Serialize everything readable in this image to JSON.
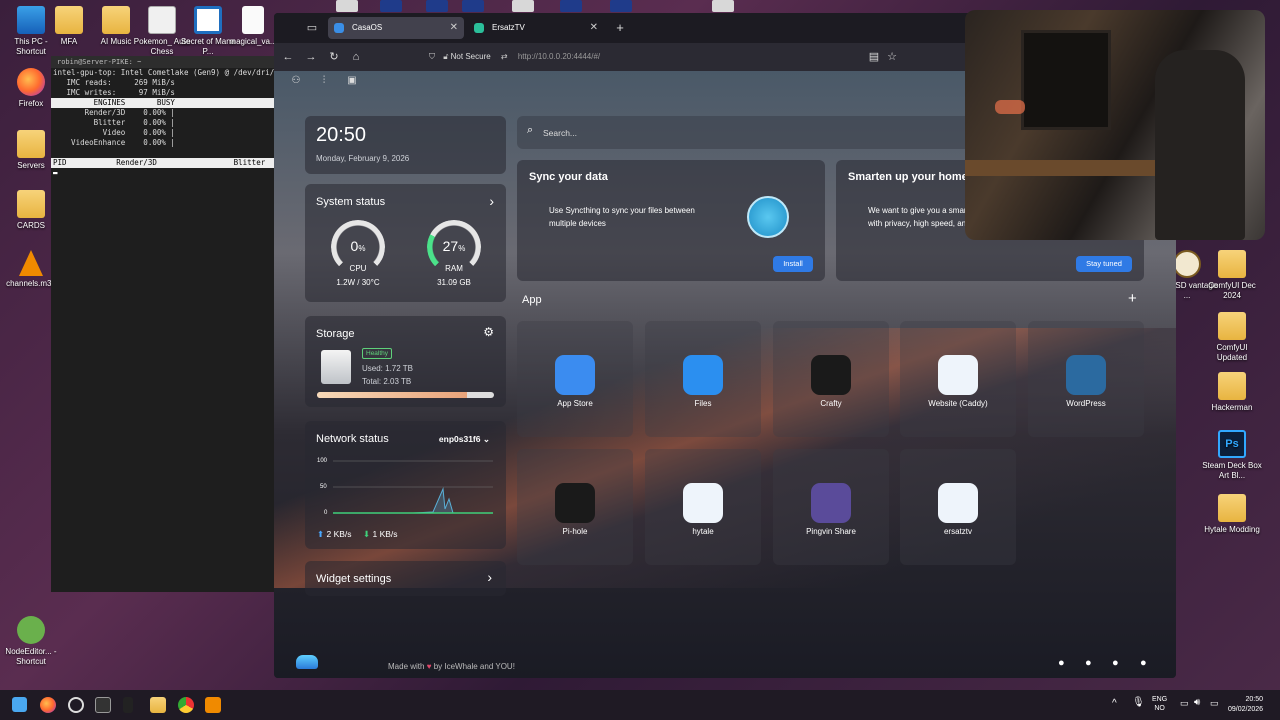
{
  "desktop": {
    "left_icons": [
      {
        "label": "This PC - Shortcut",
        "icon": "monitor-icon"
      },
      {
        "label": "Firefox",
        "icon": "firefox-icon"
      },
      {
        "label": "Servers",
        "icon": "folder-icon"
      },
      {
        "label": "CARDS",
        "icon": "folder-icon"
      },
      {
        "label": "channels.m3u",
        "icon": "vlc-icon"
      },
      {
        "label": "NodeEditor... - Shortcut",
        "icon": "node-icon"
      }
    ],
    "top_icons": [
      {
        "label": "MFA",
        "icon": "folder-icon"
      },
      {
        "label": "AI Music",
        "icon": "folder-icon"
      },
      {
        "label": "Pokemon_ Auto Chess",
        "icon": "game-icon"
      },
      {
        "label": "Secret of Mana P...",
        "icon": "app-icon"
      },
      {
        "label": "magical_va...",
        "icon": "file-icon"
      }
    ],
    "right_icons": [
      {
        "label": "ComfyUI Dec 2024",
        "icon": "folder-icon"
      },
      {
        "label": "ComfyUI Updated",
        "icon": "folder-icon"
      },
      {
        "label": "Hackerman",
        "icon": "folder-icon"
      },
      {
        "label": "Steam Deck Box Art Bl...",
        "icon": "photoshop-icon"
      },
      {
        "label": "Hytale Modding",
        "icon": "folder-icon"
      },
      {
        "label": "elkin SD vantage ...",
        "icon": "app-icon"
      }
    ]
  },
  "terminal": {
    "title": "robin@Server-PIKE: ~",
    "lines": [
      "intel-gpu-top: Intel Cometlake (Gen9) @ /dev/dri/c",
      "",
      "   IMC reads:     269 MiB/s",
      "   IMC writes:     97 MiB/s",
      ""
    ],
    "engines_header": "         ENGINES       BUSY",
    "engines": [
      "       Render/3D    0.00% |",
      "         Blitter    0.00% |",
      "           Video    0.00% |",
      "    VideoEnhance    0.00% |"
    ],
    "pid_header": "PID           Render/3D                 Blitter"
  },
  "browser": {
    "tabs": [
      {
        "label": "CasaOS",
        "color": "#3a8ee6"
      },
      {
        "label": "ErsatzTV",
        "color": "#2bbf9a"
      }
    ],
    "new_tab": "+",
    "not_secure": "Not Secure",
    "url": "http://10.0.0.20:4444/#/"
  },
  "casaos": {
    "time": "20:50",
    "date": "Monday, February 9, 2026",
    "system_status": {
      "title": "System status",
      "cpu_value": "0",
      "cpu_unit": "%",
      "cpu_label": "CPU",
      "cpu_info": "1.2W / 30°C",
      "cpu_fraction": 0.0,
      "ram_value": "27",
      "ram_unit": "%",
      "ram_label": "RAM",
      "ram_info": "31.09 GB",
      "ram_fraction": 0.27
    },
    "storage": {
      "title": "Storage",
      "badge": "Healthy",
      "used": "Used: 1.72 TB",
      "total": "Total: 2.03 TB",
      "used_fraction": 0.85
    },
    "network": {
      "title": "Network status",
      "interface": "enp0s31f6",
      "axis": [
        "100",
        "50",
        "0"
      ],
      "upload": "2 KB/s",
      "download": "1 KB/s"
    },
    "widget_settings": "Widget settings",
    "search_placeholder": "Search...",
    "promo_sync": {
      "title": "Sync your data",
      "text": "Use Syncthing to sync your files between multiple devices",
      "button": "Install"
    },
    "promo_home": {
      "title": "Smarten up your home",
      "text": "We want to give you a smar... with privacy, high speed, and...",
      "button": "Stay tuned"
    },
    "apps_title": "App",
    "add": "+",
    "apps": [
      {
        "label": "App Store",
        "icon": "app-store-icon",
        "color": "#3b8cf0"
      },
      {
        "label": "Files",
        "icon": "files-icon",
        "color": "#2b8ff0"
      },
      {
        "label": "Crafty",
        "icon": "crafty-icon",
        "color": "#1a1a1a"
      },
      {
        "label": "Website (Caddy)",
        "icon": "cube-icon",
        "color": "#eef4fb"
      },
      {
        "label": "WordPress",
        "icon": "wordpress-icon",
        "color": "#2b6aa0"
      },
      {
        "label": "Pi-hole",
        "icon": "pihole-icon",
        "color": "#1a1a1a"
      },
      {
        "label": "hytale",
        "icon": "cube-icon",
        "color": "#eef4fb"
      },
      {
        "label": "Pingvin Share",
        "icon": "penguin-icon",
        "color": "#5a4b9a"
      },
      {
        "label": "ersatztv",
        "icon": "cube-icon",
        "color": "#eef4fb"
      }
    ],
    "footer": {
      "made_with": "Made with",
      "by": "by IceWhale and YOU!"
    }
  },
  "taskbar": {
    "lang_top": "ENG",
    "lang_bottom": "NO",
    "time": "20:50",
    "date": "09/02/2026"
  }
}
